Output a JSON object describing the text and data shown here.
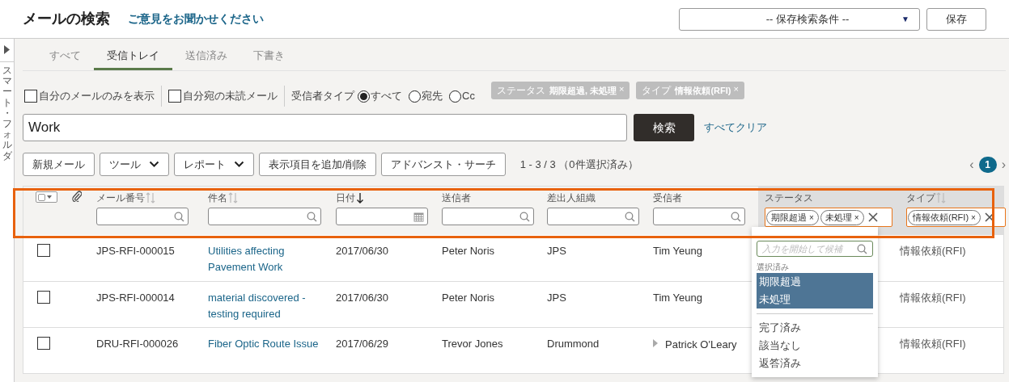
{
  "header": {
    "title": "メールの検索",
    "feedback_link": "ご意見をお聞かせください",
    "saved_search": {
      "value": "-- 保存検索条件 --",
      "caret": "▼"
    },
    "save_button": "保存"
  },
  "side_rail": {
    "label": "スマート・フォルダ"
  },
  "tabs": [
    {
      "label": "すべて",
      "selected": false
    },
    {
      "label": "受信トレイ",
      "selected": true
    },
    {
      "label": "送信済み",
      "selected": false
    },
    {
      "label": "下書き",
      "selected": false
    }
  ],
  "filters": {
    "checkboxes": [
      {
        "label": "自分のメールのみを表示",
        "checked": false
      },
      {
        "label": "自分宛の未読メール",
        "checked": false
      }
    ],
    "recipient_type": {
      "label": "受信者タイプ",
      "options": [
        {
          "label": "すべて",
          "selected": true
        },
        {
          "label": "宛先",
          "selected": false
        },
        {
          "label": "Cc",
          "selected": false
        }
      ]
    },
    "chips": [
      {
        "name": "ステータス",
        "value": "期限超過, 未処理",
        "remove": "×"
      },
      {
        "name": "タイプ",
        "value": "情報依頼(RFI)",
        "remove": "×"
      }
    ]
  },
  "search": {
    "value": "Work",
    "button": "検索",
    "clear_link": "すべてクリア"
  },
  "toolbar": {
    "buttons": [
      {
        "label": "新規メール",
        "kind": "plain"
      },
      {
        "label": "ツール",
        "kind": "menu"
      },
      {
        "label": "レポート",
        "kind": "menu"
      },
      {
        "label": "表示項目を追加/削除",
        "kind": "plain"
      },
      {
        "label": "アドバンスト・サーチ",
        "kind": "plain"
      }
    ],
    "count": "1 - 3 / 3 （0件選択済み）",
    "pagination": {
      "prev": "‹",
      "page": "1",
      "next": "›"
    }
  },
  "table": {
    "select_all": {
      "checked": false
    },
    "columns": [
      {
        "label": "メール番号",
        "sort_arrows": true,
        "sorted_desc": false,
        "kind": "search"
      },
      {
        "label": "件名",
        "sort_arrows": true,
        "sorted_desc": false,
        "kind": "search"
      },
      {
        "label": "日付",
        "sort_arrows": false,
        "sorted_desc": true,
        "kind": "date"
      },
      {
        "label": "送信者",
        "sort_arrows": false,
        "sorted_desc": false,
        "kind": "search"
      },
      {
        "label": "差出人組織",
        "sort_arrows": false,
        "sorted_desc": false,
        "kind": "search"
      },
      {
        "label": "受信者",
        "sort_arrows": false,
        "sorted_desc": false,
        "kind": "search"
      },
      {
        "label": "ステータス",
        "sort_arrows": false,
        "sorted_desc": false,
        "kind": "tags",
        "tags": [
          {
            "label": "期限超過",
            "remove": "×"
          },
          {
            "label": "未処理",
            "remove": "×"
          }
        ]
      },
      {
        "label": "タイプ",
        "sort_arrows": true,
        "sorted_desc": false,
        "kind": "tags",
        "tags": [
          {
            "label": "情報依頼(RFI)",
            "remove": "×"
          }
        ]
      }
    ],
    "rows": [
      {
        "checked": false,
        "number": "JPS-RFI-000015",
        "subject": "Utilities affecting Pavement Work",
        "date": "2017/06/30",
        "sender": "Peter Noris",
        "org": "JPS",
        "recipient": "Tim Yeung",
        "recipient_expandable": false,
        "type": "情報依頼(RFI)"
      },
      {
        "checked": false,
        "number": "JPS-RFI-000014",
        "subject": "material discovered - testing required",
        "date": "2017/06/30",
        "sender": "Peter Noris",
        "org": "JPS",
        "recipient": "Tim Yeung",
        "recipient_expandable": false,
        "type": "情報依頼(RFI)"
      },
      {
        "checked": false,
        "number": "DRU-RFI-000026",
        "subject": "Fiber Optic Route Issue",
        "date": "2017/06/29",
        "sender": "Trevor Jones",
        "org": "Drummond",
        "recipient": "Patrick O'Leary",
        "recipient_expandable": true,
        "type": "情報依頼(RFI)"
      }
    ]
  },
  "status_dropdown": {
    "placeholder": "入力を開始して候補",
    "selected_heading": "選択済み",
    "options": [
      {
        "label": "期限超過",
        "selected": true
      },
      {
        "label": "未処理",
        "selected": true
      },
      {
        "label": "完了済み",
        "selected": false
      },
      {
        "label": "該当なし",
        "selected": false
      },
      {
        "label": "返答済み",
        "selected": false
      }
    ]
  }
}
